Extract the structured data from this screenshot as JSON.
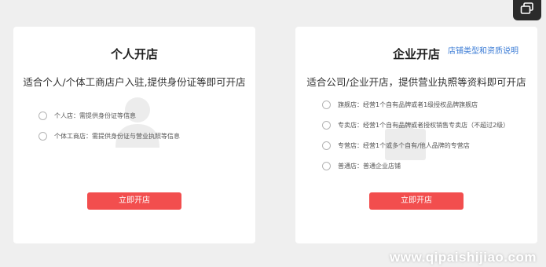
{
  "personal": {
    "title": "个人开店",
    "subtitle": "适合个人/个体工商店户入驻,提供身份证等即可开店",
    "options": [
      {
        "label": "个人店：需提供身份证等信息"
      },
      {
        "label": "个体工商店：需提供身份证与营业执照等信息"
      }
    ],
    "cta": "立即开店",
    "watermark_icon": "user-icon"
  },
  "enterprise": {
    "title": "企业开店",
    "help_link": "店铺类型和资质说明",
    "subtitle": "适合公司/企业开店，提供营业执照等资料即可开店",
    "options": [
      {
        "label": "旗舰店：经营1个自有品牌或者1级授权品牌旗舰店"
      },
      {
        "label": "专卖店：经营1个自有品牌或者授权销售专卖店（不超过2级）"
      },
      {
        "label": "专营店：经营1个或多个自有/他人品牌的专营店"
      },
      {
        "label": "普通店：普通企业店铺"
      }
    ],
    "cta": "立即开店",
    "watermark_icon": "enterprise-icon"
  },
  "corner_button_icon": "restore-window-icon",
  "site_watermark": "www.qipaishijiao.com",
  "colors": {
    "cta": "#f24e4e",
    "link": "#3a7bd5",
    "background": "#efefef"
  }
}
